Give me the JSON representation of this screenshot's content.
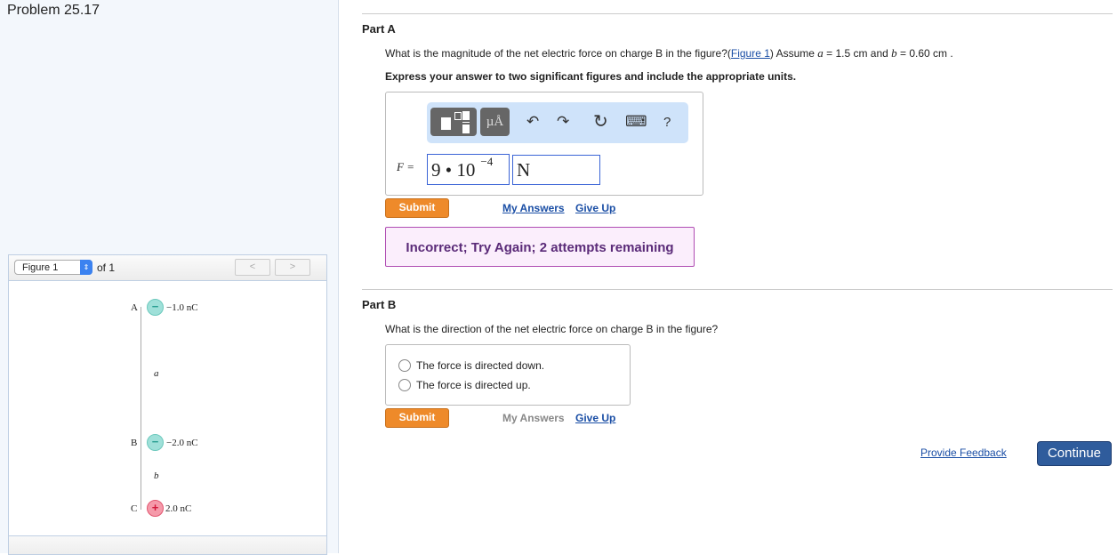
{
  "problem_title": "Problem 25.17",
  "figure": {
    "select_value": "Figure 1",
    "of_label": "of 1",
    "prev": "<",
    "next": ">",
    "charges": [
      {
        "label": "A",
        "value": "−1.0 nC",
        "sign": "−"
      },
      {
        "label": "B",
        "value": "−2.0 nC",
        "sign": "−"
      },
      {
        "label": "C",
        "value": "2.0 nC",
        "sign": "+"
      }
    ],
    "dist_a": "a",
    "dist_b": "b"
  },
  "partA": {
    "title": "Part A",
    "question_pre": "What is the magnitude of the net electric force on charge B in the figure?(",
    "figure_link": "Figure 1",
    "question_post": ") Assume ",
    "a_var": "a",
    "a_val": " = 1.5 cm and ",
    "b_var": "b",
    "b_val": " = 0.60 cm .",
    "instruction": "Express your answer to two significant figures and include the appropriate units.",
    "toolbar": {
      "units": "µÅ",
      "undo": "↶",
      "redo": "↷",
      "reset": "↻",
      "keyboard": "⌨",
      "help": "?"
    },
    "var_label": "F =",
    "value_mantissa": "9 • 10",
    "value_exp": "−4",
    "unit": "N",
    "submit": "Submit",
    "my_answers": "My Answers",
    "give_up": "Give Up",
    "feedback": "Incorrect; Try Again; 2 attempts remaining"
  },
  "partB": {
    "title": "Part B",
    "question": "What is the direction of the net electric force on charge B in the figure?",
    "options": [
      "The force is directed down.",
      "The force is directed up."
    ],
    "submit": "Submit",
    "my_answers": "My Answers",
    "give_up": "Give Up"
  },
  "footer": {
    "provide_feedback": "Provide Feedback",
    "continue": "Continue"
  }
}
